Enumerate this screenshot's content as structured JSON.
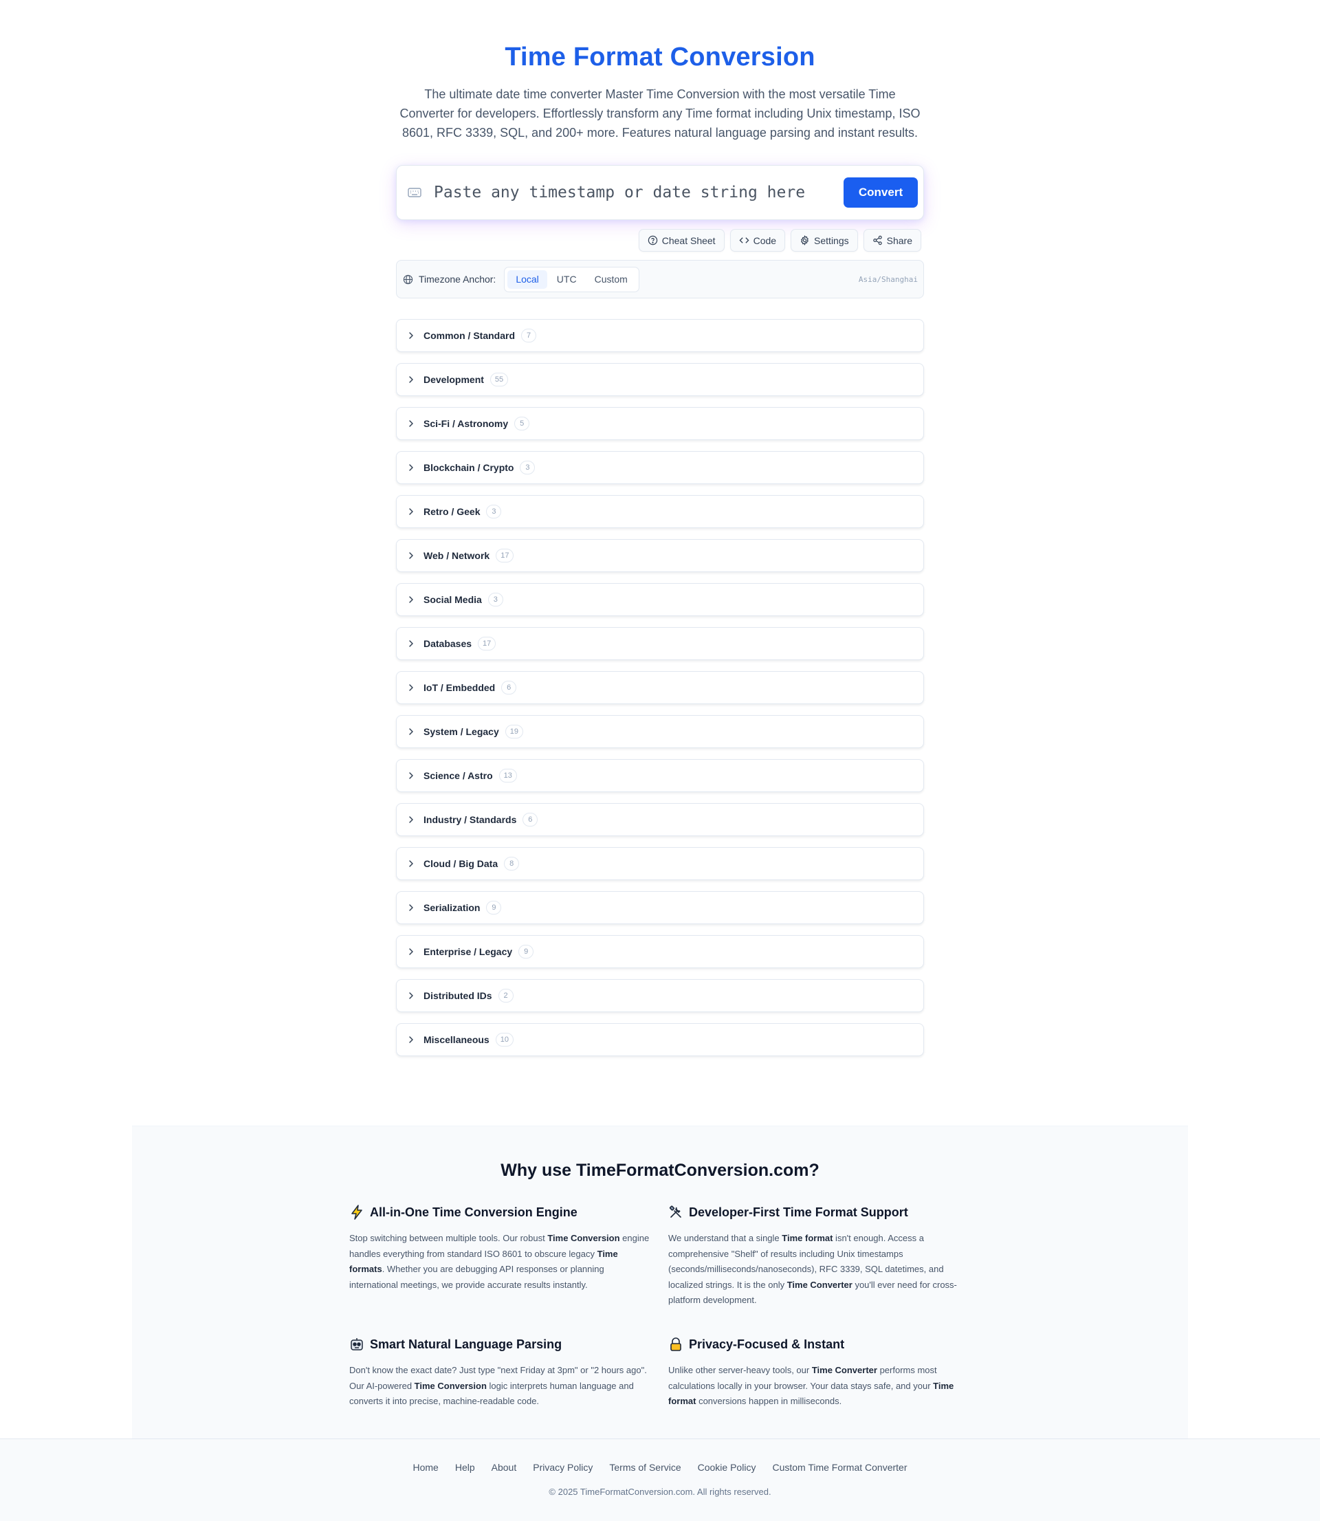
{
  "hero": {
    "title": "Time Format Conversion",
    "description": "The ultimate date time converter Master Time Conversion with the most versatile Time Converter for developers. Effortlessly transform any Time format including Unix timestamp, ISO 8601, RFC 3339, SQL, and 200+ more. Features natural language parsing and instant results."
  },
  "search": {
    "placeholder": "Paste any timestamp or date string here",
    "value": "",
    "convert_label": "Convert",
    "icon": "keyboard-icon"
  },
  "toolbar": {
    "buttons": [
      {
        "label": "Cheat Sheet",
        "icon": "help-circle-icon"
      },
      {
        "label": "Code",
        "icon": "code-icon"
      },
      {
        "label": "Settings",
        "icon": "gear-icon"
      },
      {
        "label": "Share",
        "icon": "share-icon"
      }
    ]
  },
  "timezone": {
    "label": "Timezone Anchor:",
    "options": [
      "Local",
      "UTC",
      "Custom"
    ],
    "selected": "Local",
    "current": "Asia/Shanghai"
  },
  "categories": [
    {
      "label": "Common / Standard",
      "count": "7"
    },
    {
      "label": "Development",
      "count": "55"
    },
    {
      "label": "Sci-Fi / Astronomy",
      "count": "5"
    },
    {
      "label": "Blockchain / Crypto",
      "count": "3"
    },
    {
      "label": "Retro / Geek",
      "count": "3"
    },
    {
      "label": "Web / Network",
      "count": "17"
    },
    {
      "label": "Social Media",
      "count": "3"
    },
    {
      "label": "Databases",
      "count": "17"
    },
    {
      "label": "IoT / Embedded",
      "count": "6"
    },
    {
      "label": "System / Legacy",
      "count": "19"
    },
    {
      "label": "Science / Astro",
      "count": "13"
    },
    {
      "label": "Industry / Standards",
      "count": "6"
    },
    {
      "label": "Cloud / Big Data",
      "count": "8"
    },
    {
      "label": "Serialization",
      "count": "9"
    },
    {
      "label": "Enterprise / Legacy",
      "count": "9"
    },
    {
      "label": "Distributed IDs",
      "count": "2"
    },
    {
      "label": "Miscellaneous",
      "count": "10"
    }
  ],
  "why": {
    "title": "Why use TimeFormatConversion.com?",
    "features": [
      {
        "icon": "lightning-icon",
        "title": "All-in-One Time Conversion Engine",
        "segments": [
          {
            "t": "Stop switching between multiple tools. Our robust "
          },
          {
            "t": "Time Conversion",
            "b": true
          },
          {
            "t": " engine handles everything from standard ISO 8601 to obscure legacy "
          },
          {
            "t": "Time formats",
            "b": true
          },
          {
            "t": ". Whether you are debugging API responses or planning international meetings, we provide accurate results instantly."
          }
        ]
      },
      {
        "icon": "tools-icon",
        "title": "Developer-First Time Format Support",
        "segments": [
          {
            "t": "We understand that a single "
          },
          {
            "t": "Time format",
            "b": true
          },
          {
            "t": " isn't enough. Access a comprehensive \"Shelf\" of results including Unix timestamps (seconds/milliseconds/nanoseconds), RFC 3339, SQL datetimes, and localized strings. It is the only "
          },
          {
            "t": "Time Converter",
            "b": true
          },
          {
            "t": " you'll ever need for cross-platform development."
          }
        ]
      },
      {
        "icon": "robot-icon",
        "title": "Smart Natural Language Parsing",
        "segments": [
          {
            "t": "Don't know the exact date? Just type \"next Friday at 3pm\" or \"2 hours ago\". Our AI-powered "
          },
          {
            "t": "Time Conversion",
            "b": true
          },
          {
            "t": " logic interprets human language and converts it into precise, machine-readable code."
          }
        ]
      },
      {
        "icon": "lock-icon",
        "title": "Privacy-Focused & Instant",
        "segments": [
          {
            "t": "Unlike other server-heavy tools, our "
          },
          {
            "t": "Time Converter",
            "b": true
          },
          {
            "t": " performs most calculations locally in your browser. Your data stays safe, and your "
          },
          {
            "t": "Time format",
            "b": true
          },
          {
            "t": " conversions happen in milliseconds."
          }
        ]
      }
    ]
  },
  "footer": {
    "links": [
      "Home",
      "Help",
      "About",
      "Privacy Policy",
      "Terms of Service",
      "Cookie Policy",
      "Custom Time Format Converter"
    ],
    "copyright": "© 2025 TimeFormatConversion.com. All rights reserved."
  },
  "colors": {
    "accent": "#1d5fe8",
    "button": "#1a5ef0",
    "text": "#0f172a",
    "muted": "#475569"
  }
}
